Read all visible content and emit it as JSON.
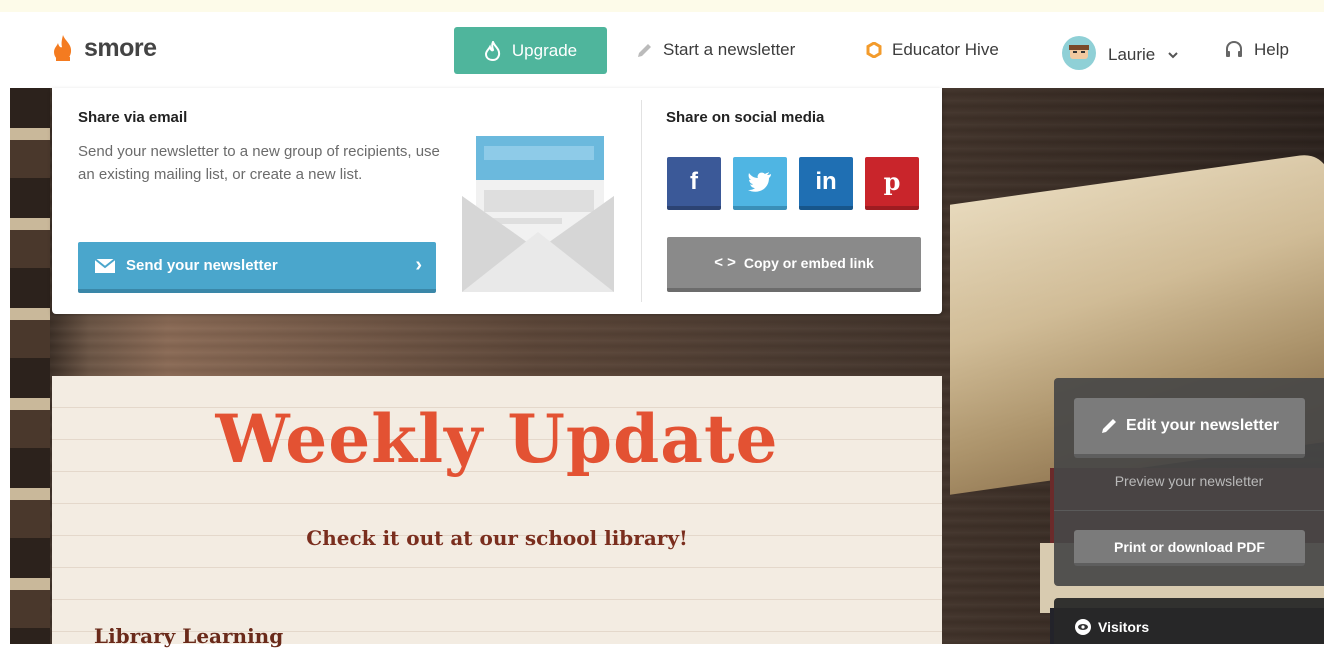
{
  "brand": {
    "name": "smore",
    "accent": "#f47b20"
  },
  "header": {
    "upgrade_label": "Upgrade",
    "start_label": "Start a newsletter",
    "hive_label": "Educator Hive",
    "user_name": "Laurie",
    "help_label": "Help"
  },
  "share": {
    "email_title": "Share via email",
    "email_desc": "Send your newsletter to a new group of recipients, use an existing mailing list, or create a new list.",
    "send_label": "Send your newsletter",
    "social_title": "Share on social media",
    "social": [
      {
        "name": "facebook",
        "glyph": "f"
      },
      {
        "name": "twitter",
        "glyph": "twitter-bird"
      },
      {
        "name": "linkedin",
        "glyph": "in"
      },
      {
        "name": "pinterest",
        "glyph": "p"
      }
    ],
    "copy_label": "Copy or embed link"
  },
  "newsletter": {
    "title": "Weekly Update",
    "subtitle": "Check it out at our school library!",
    "section_title": "Library Learning"
  },
  "side": {
    "edit_label": "Edit your newsletter",
    "preview_label": "Preview your newsletter",
    "print_label": "Print or download PDF",
    "visitors_label": "Visitors"
  }
}
